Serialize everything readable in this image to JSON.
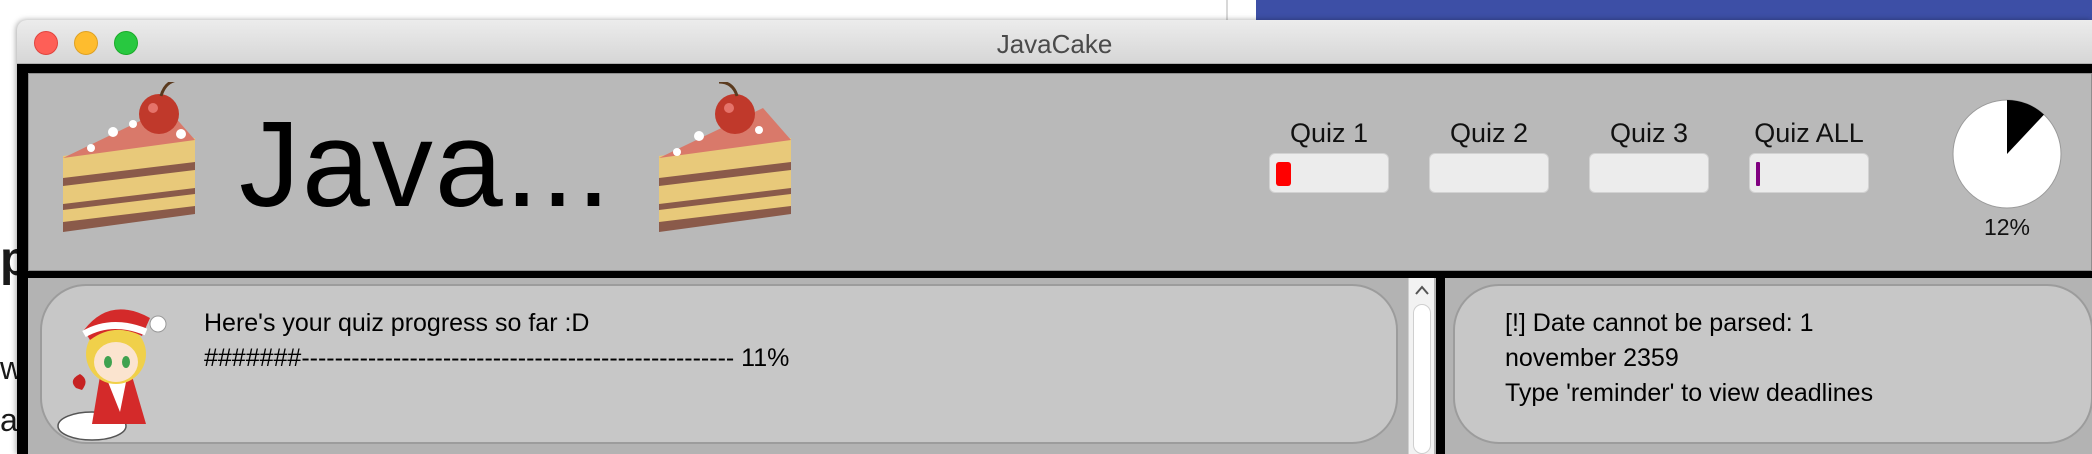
{
  "window": {
    "title": "JavaCake"
  },
  "background": {
    "fragment_1": "p",
    "fragment_2": "w",
    "fragment_3": "ai"
  },
  "header": {
    "app_name": "Java...",
    "quizzes": [
      {
        "label": "Quiz 1",
        "progress": 0.14,
        "color": "#ff0000"
      },
      {
        "label": "Quiz 2",
        "progress": 0.0,
        "color": "#ff0000"
      },
      {
        "label": "Quiz 3",
        "progress": 0.0,
        "color": "#ff0000"
      },
      {
        "label": "Quiz ALL",
        "progress": 0.03,
        "color": "#800080"
      }
    ],
    "overall": {
      "percent_label": "12%",
      "value": 0.12
    }
  },
  "dialog": {
    "line_1": "Here's your quiz progress so far :D",
    "line_2": "#######---------------------------------------------------- 11%"
  },
  "reminder": {
    "line_1": "[!] Date cannot be parsed: 1",
    "line_2": "november 2359",
    "line_3": "Type 'reminder' to view deadlines"
  },
  "colors": {
    "cake_frosting": "#d9796a",
    "cake_cream": "#e8c97a",
    "cake_chocolate": "#8a5a4a",
    "cherry": "#c0392b"
  }
}
